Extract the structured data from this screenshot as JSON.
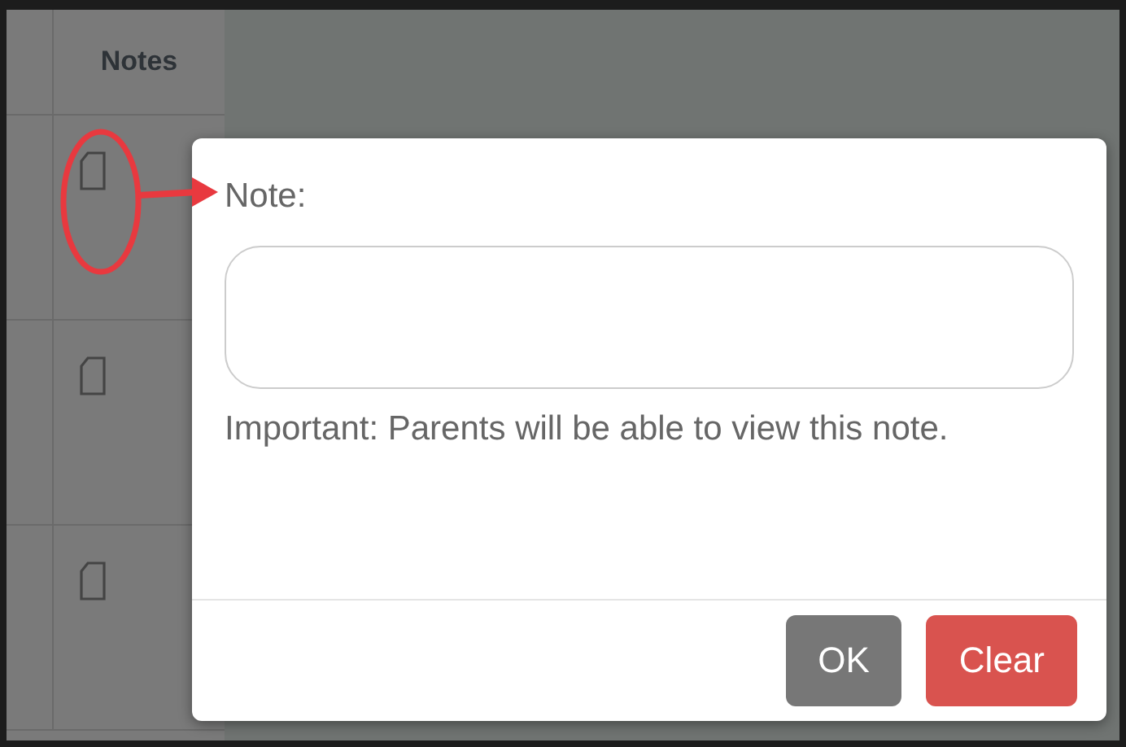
{
  "table": {
    "header": "Notes",
    "rows": [
      {
        "kind": "note"
      },
      {
        "kind": "note"
      },
      {
        "kind": "note"
      }
    ]
  },
  "dialog": {
    "label": "Note:",
    "message": "Important: Parents will be able to view this note.",
    "buttons": [
      {
        "label": "OK",
        "kind": "default"
      },
      {
        "label": "Clear",
        "kind": "danger"
      }
    ]
  }
}
